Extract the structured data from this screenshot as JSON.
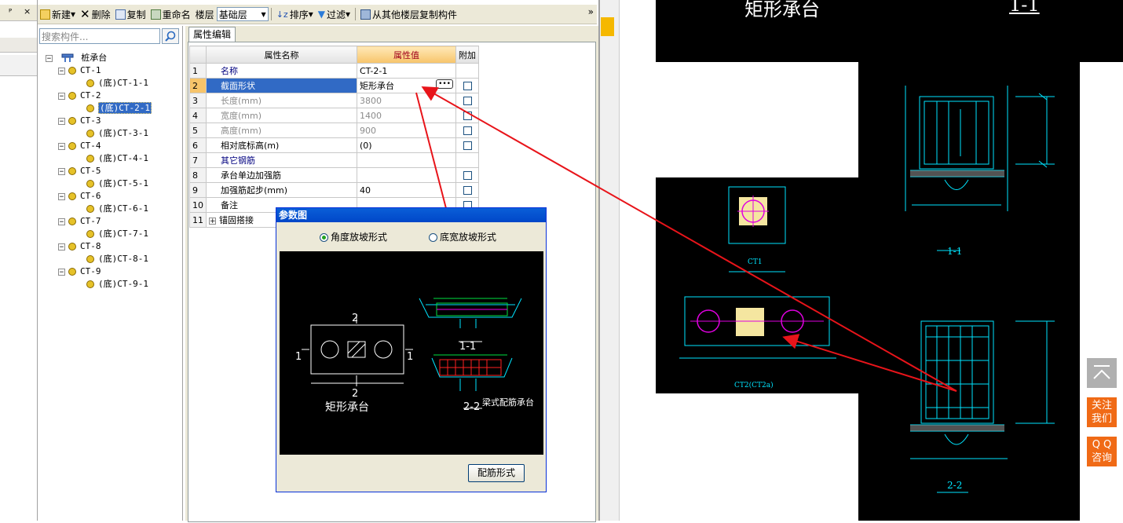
{
  "toolbar": {
    "new": "新建",
    "delete": "删除",
    "copy": "复制",
    "rename": "重命名",
    "floor_label": "楼层",
    "floor_value": "基础层",
    "sort": "排序",
    "filter": "过滤",
    "copy_from_floor": "从其他楼层复制构件",
    "overflow": "»"
  },
  "panel_controls": {
    "pin": "ᴾ",
    "close": "×"
  },
  "tree": {
    "search_placeholder": "搜索构件...",
    "root": "桩承台",
    "groups": [
      {
        "name": "CT-1",
        "child": "(底)CT-1-1"
      },
      {
        "name": "CT-2",
        "child": "(底)CT-2-1"
      },
      {
        "name": "CT-3",
        "child": "(底)CT-3-1"
      },
      {
        "name": "CT-4",
        "child": "(底)CT-4-1"
      },
      {
        "name": "CT-5",
        "child": "(底)CT-5-1"
      },
      {
        "name": "CT-6",
        "child": "(底)CT-6-1"
      },
      {
        "name": "CT-7",
        "child": "(底)CT-7-1"
      },
      {
        "name": "CT-8",
        "child": "(底)CT-8-1"
      },
      {
        "name": "CT-9",
        "child": "(底)CT-9-1"
      }
    ]
  },
  "props": {
    "tab": "属性编辑",
    "headers": {
      "name": "属性名称",
      "value": "属性值",
      "extra": "附加"
    },
    "rows": [
      {
        "n": "1",
        "name": "名称",
        "value": "CT-2-1"
      },
      {
        "n": "2",
        "name": "截面形状",
        "value": "矩形承台"
      },
      {
        "n": "3",
        "name": "长度(mm)",
        "value": "3800"
      },
      {
        "n": "4",
        "name": "宽度(mm)",
        "value": "1400"
      },
      {
        "n": "5",
        "name": "高度(mm)",
        "value": "900"
      },
      {
        "n": "6",
        "name": "相对底标高(m)",
        "value": "(0)"
      },
      {
        "n": "7",
        "name": "其它钢筋",
        "value": ""
      },
      {
        "n": "8",
        "name": "承台单边加强筋",
        "value": ""
      },
      {
        "n": "9",
        "name": "加强筋起步(mm)",
        "value": "40"
      },
      {
        "n": "10",
        "name": "备注",
        "value": ""
      },
      {
        "n": "11",
        "name": "锚固搭接",
        "value": ""
      }
    ]
  },
  "dialog": {
    "title": "参数图",
    "radio1": "角度放坡形式",
    "radio2": "底宽放坡形式",
    "drawing": {
      "label_2_top": "2",
      "label_1_left": "1",
      "label_1_right": "1",
      "label_2_bottom": "2",
      "caption": "矩形承台",
      "sec11": "1-1",
      "sec22": "2-2",
      "beam_caption": "梁式配筋承台"
    },
    "button": "配筋形式"
  },
  "cad": {
    "title_left": "矩形承台",
    "title_right": "1-1",
    "sec11": "1-1",
    "sec22": "2-2",
    "ct1": "CT1",
    "ct2": "CT2(CT2a)"
  },
  "side": {
    "follow": [
      "关注",
      "我们"
    ],
    "qq": [
      "Q Q",
      "咨询"
    ]
  },
  "colors": {
    "selection": "#316ac5",
    "arrow": "#e8141a",
    "cad_line": "#00e5ff",
    "side_orange": "#f06a16"
  }
}
